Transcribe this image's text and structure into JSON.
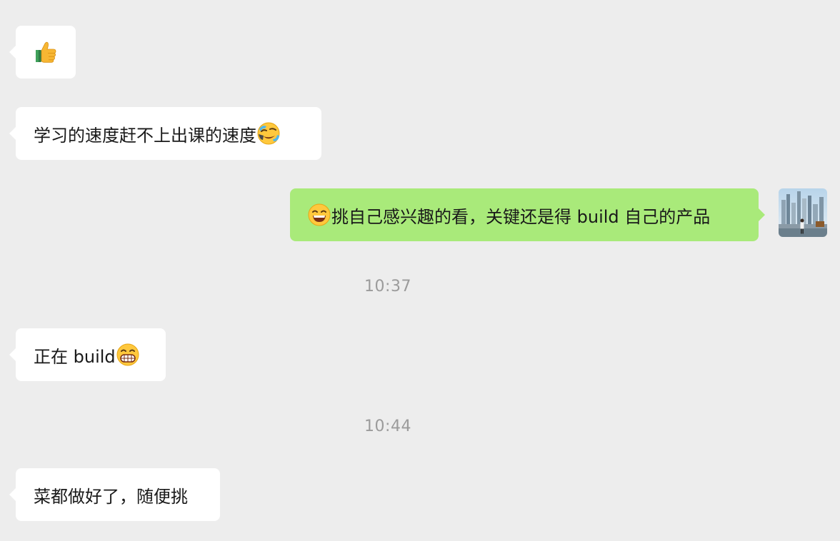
{
  "messages": [
    {
      "id": "m1",
      "direction": "in",
      "text": "",
      "emoji_after": "thumbs-up-icon"
    },
    {
      "id": "m2",
      "direction": "in",
      "text": "学习的速度赶不上出课的速度",
      "emoji_after": "face-with-tears-icon"
    },
    {
      "id": "m3",
      "direction": "out",
      "emoji_before": "grinning-squinting-face-icon",
      "text": "挑自己感兴趣的看，关键还是得 build 自己的产品"
    },
    {
      "id": "m4",
      "direction": "in",
      "text": "正在 build",
      "emoji_after": "grimacing-grin-face-icon"
    },
    {
      "id": "m5",
      "direction": "in",
      "text": "菜都做好了，随便挑"
    }
  ],
  "timestamps": [
    "10:37",
    "10:44"
  ],
  "colors": {
    "background": "#ededed",
    "incoming_bubble": "#ffffff",
    "outgoing_bubble": "#a9ea7a",
    "timestamp_text": "#9b9b9b",
    "message_text": "#191919"
  },
  "avatar": {
    "icon": "user-avatar-city-skyline"
  }
}
